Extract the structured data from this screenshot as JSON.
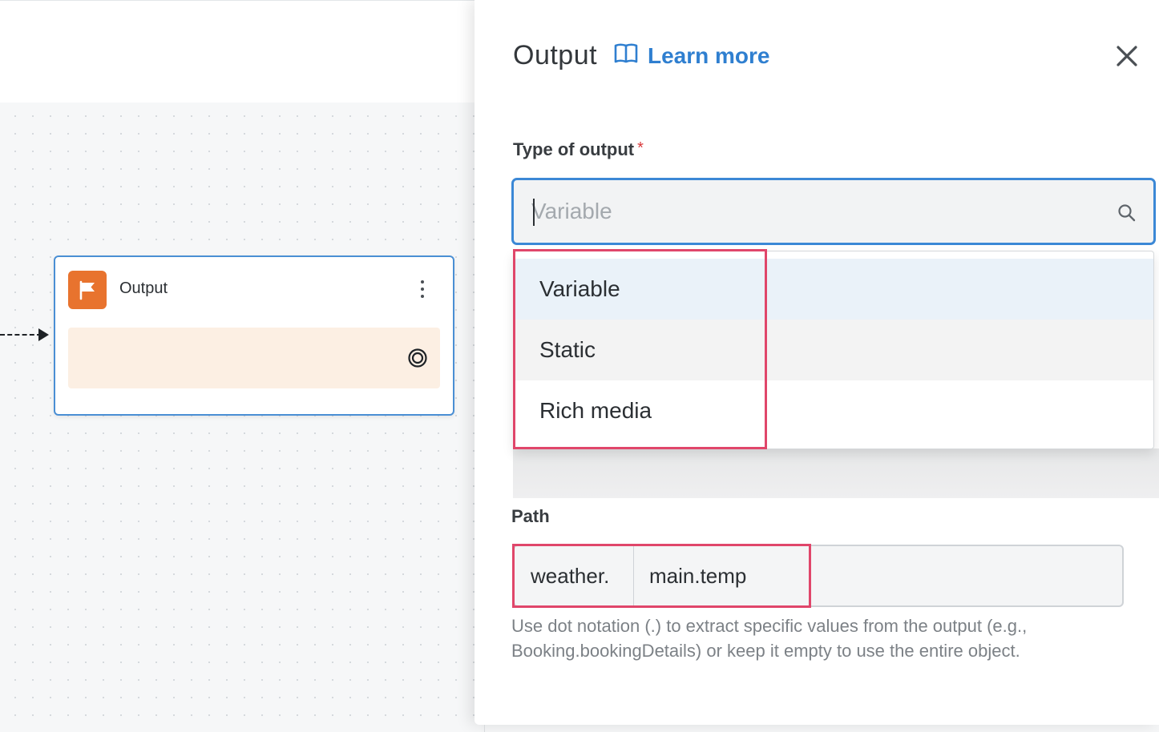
{
  "canvas": {
    "node": {
      "title": "Output",
      "icon": "flag-icon",
      "icon_color": "#e8732e",
      "body_color": "#fcefe3"
    }
  },
  "panel": {
    "title": "Output",
    "learn_more": "Learn more",
    "type_field": {
      "label": "Type of output",
      "required_mark": "*",
      "placeholder": "Variable",
      "options": [
        "Variable",
        "Static",
        "Rich media"
      ]
    },
    "path_field": {
      "label": "Path",
      "prefix": "weather.",
      "value": "main.temp",
      "help": "Use dot notation (.) to extract specific values from the output (e.g., Booking.bookingDetails) or keep it empty to use the entire object."
    }
  },
  "colors": {
    "accent": "#2f7fd0",
    "focus_border": "#3b88d6",
    "required": "#d9393b",
    "highlight": "#e0466a"
  }
}
